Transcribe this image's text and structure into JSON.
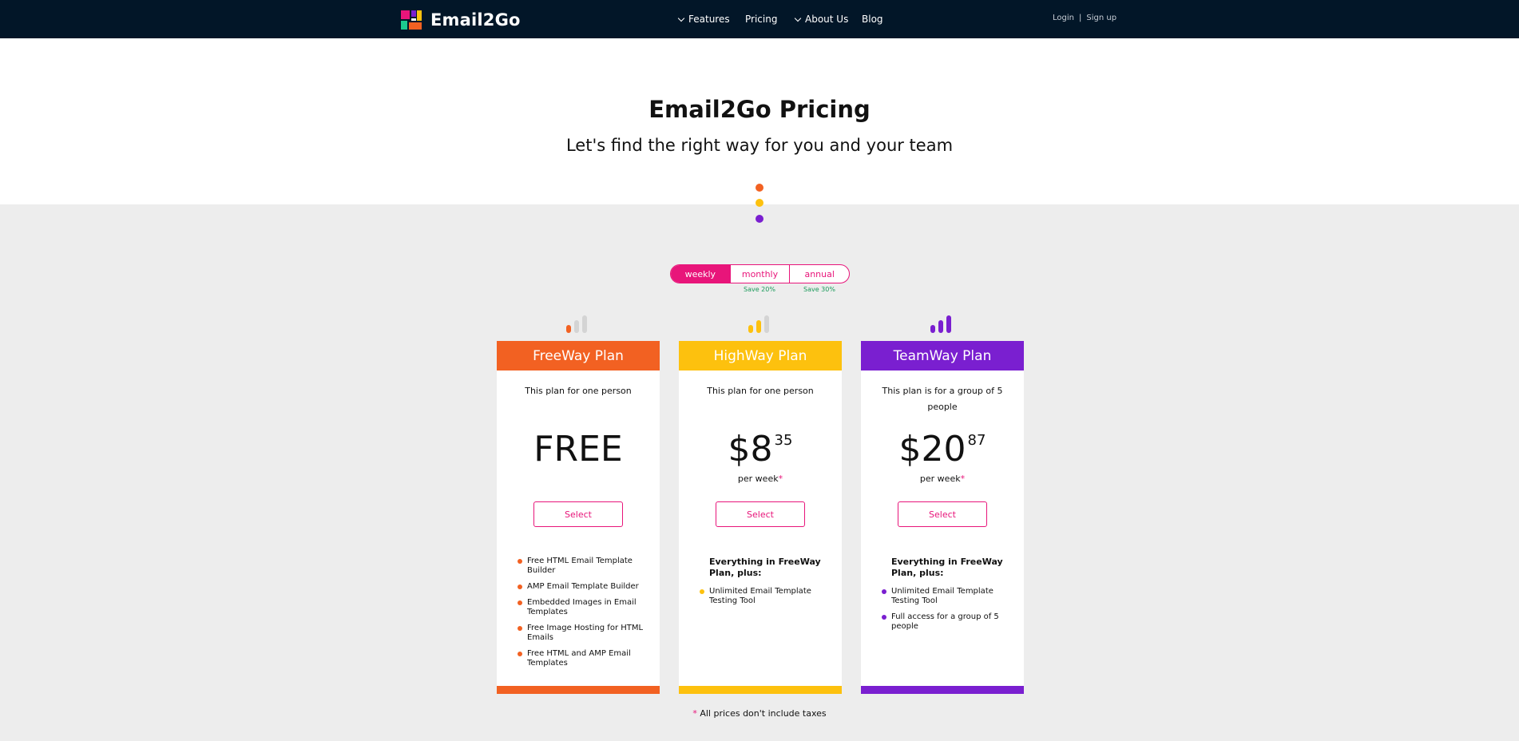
{
  "header": {
    "logo_text": "Email2Go",
    "nav": {
      "features": "Features",
      "pricing": "Pricing",
      "about": "About Us",
      "blog": "Blog"
    },
    "auth": {
      "login": "Login",
      "separator": "|",
      "signup": "Sign up"
    }
  },
  "hero": {
    "title": "Email2Go Pricing",
    "subtitle": "Let's find the right way for you and your team"
  },
  "billing": {
    "options": [
      "weekly",
      "monthly",
      "annual"
    ],
    "selected": "weekly",
    "save_monthly": "Save 20%",
    "save_annual": "Save 30%"
  },
  "plans": {
    "free": {
      "name": "FreeWay Plan",
      "description": "This plan for one person",
      "price": "FREE",
      "select_label": "Select",
      "color": "#f26122",
      "features": [
        "Free HTML Email Template Builder",
        "AMP Email Template Builder",
        "Embedded Images in Email Templates",
        "Free Image Hosting for HTML Emails",
        "Free HTML and AMP Email Templates"
      ]
    },
    "high": {
      "name": "HighWay Plan",
      "description": "This plan for one person",
      "price_main": "$8",
      "price_cents": "35",
      "period": "per week",
      "asterisk": "*",
      "select_label": "Select",
      "color": "#fdc10e",
      "features_heading": "Everything in FreeWay Plan, plus:",
      "features": [
        "Unlimited Email Template Testing Tool"
      ]
    },
    "team": {
      "name": "TeamWay Plan",
      "description": "This plan is for a group of 5 people",
      "price_main": "$20",
      "price_cents": "87",
      "period": "per week",
      "asterisk": "*",
      "select_label": "Select",
      "color": "#7a1fd0",
      "features_heading": "Everything in FreeWay Plan, plus:",
      "features": [
        "Unlimited Email Template Testing Tool",
        "Full access for a group of 5 people"
      ]
    }
  },
  "footnote": {
    "asterisk": "*",
    "text": "All prices don't include taxes"
  },
  "colors": {
    "accent": "#e8157a",
    "header_bg": "#021628",
    "free": "#f26122",
    "high": "#fdc10e",
    "team": "#7a1fd0"
  }
}
